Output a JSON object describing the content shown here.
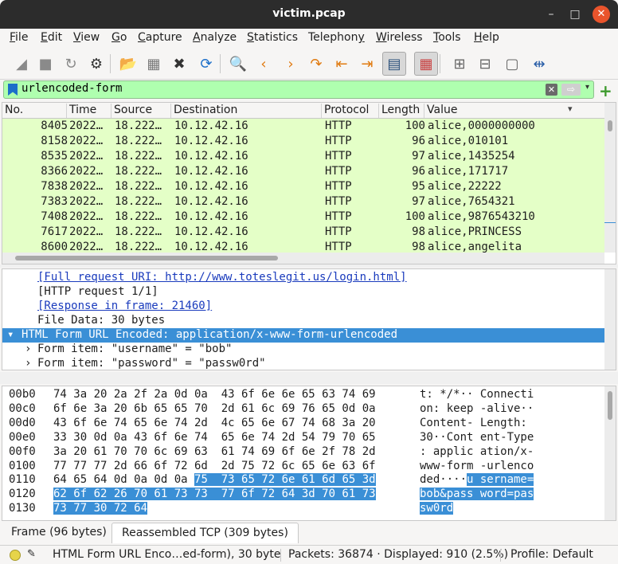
{
  "window": {
    "title": "victim.pcap",
    "minimize": "–",
    "maximize": "□",
    "close": "✕"
  },
  "menu": [
    {
      "key": "F",
      "rest": "ile"
    },
    {
      "key": "E",
      "rest": "dit"
    },
    {
      "key": "V",
      "rest": "iew"
    },
    {
      "key": "G",
      "rest": "o"
    },
    {
      "key": "C",
      "rest": "apture"
    },
    {
      "key": "A",
      "rest": "nalyze"
    },
    {
      "key": "S",
      "rest": "tatistics"
    },
    {
      "key": "",
      "rest": "Telephon",
      "key2": "y"
    },
    {
      "key": "W",
      "rest": "ireless"
    },
    {
      "key": "T",
      "rest": "ools"
    },
    {
      "key": "H",
      "rest": "elp"
    }
  ],
  "toolbar": {
    "icons": [
      "shark-fin-start-icon",
      "stop-capture-icon",
      "restart-capture-icon",
      "capture-options-icon",
      "open-file-icon",
      "save-file-icon",
      "close-file-icon",
      "reload-file-icon",
      "find-packet-icon",
      "go-back-icon",
      "go-forward-icon",
      "go-to-packet-icon",
      "go-first-icon",
      "go-last-icon",
      "autoscroll-icon",
      "colorize-icon",
      "zoom-in-icon",
      "zoom-out-icon",
      "normal-size-icon",
      "resize-columns-icon"
    ]
  },
  "filter": {
    "value": "urlencoded-form",
    "apply_glyph": "⇨",
    "clear_glyph": "✕",
    "dropdown_glyph": "▾",
    "add_glyph": "+"
  },
  "packet_list": {
    "columns": [
      "No.",
      "Time",
      "Source",
      "Destination",
      "Protocol",
      "Length",
      "Value"
    ],
    "sort_glyph": "▾",
    "rows": [
      {
        "no": "8405",
        "time": "2022…",
        "src": "18.222…",
        "dst": "10.12.42.16",
        "proto": "HTTP",
        "len": "100",
        "value": "alice,0000000000"
      },
      {
        "no": "8158",
        "time": "2022…",
        "src": "18.222…",
        "dst": "10.12.42.16",
        "proto": "HTTP",
        "len": "96",
        "value": "alice,010101"
      },
      {
        "no": "8535",
        "time": "2022…",
        "src": "18.222…",
        "dst": "10.12.42.16",
        "proto": "HTTP",
        "len": "97",
        "value": "alice,1435254"
      },
      {
        "no": "8366",
        "time": "2022…",
        "src": "18.222…",
        "dst": "10.12.42.16",
        "proto": "HTTP",
        "len": "96",
        "value": "alice,171717"
      },
      {
        "no": "7838",
        "time": "2022…",
        "src": "18.222…",
        "dst": "10.12.42.16",
        "proto": "HTTP",
        "len": "95",
        "value": "alice,22222"
      },
      {
        "no": "7383",
        "time": "2022…",
        "src": "18.222…",
        "dst": "10.12.42.16",
        "proto": "HTTP",
        "len": "97",
        "value": "alice,7654321"
      },
      {
        "no": "7408",
        "time": "2022…",
        "src": "18.222…",
        "dst": "10.12.42.16",
        "proto": "HTTP",
        "len": "100",
        "value": "alice,9876543210"
      },
      {
        "no": "7617",
        "time": "2022…",
        "src": "18.222…",
        "dst": "10.12.42.16",
        "proto": "HTTP",
        "len": "98",
        "value": "alice,PRINCESS"
      },
      {
        "no": "8600",
        "time": "2022…",
        "src": "18.222…",
        "dst": "10.12.42.16",
        "proto": "HTTP",
        "len": "98",
        "value": "alice,angelita"
      }
    ]
  },
  "details": {
    "lines": [
      {
        "text": "[Full request URI: http://www.toteslegit.us/login.html]",
        "link": true
      },
      {
        "text": "[HTTP request 1/1]",
        "link": false
      },
      {
        "text": "[Response in frame: 21460]",
        "link": true
      },
      {
        "text": "File Data: 30 bytes",
        "link": false
      }
    ],
    "selected": {
      "arrow": "▾",
      "text": "HTML Form URL Encoded: application/x-www-form-urlencoded"
    },
    "children": [
      {
        "arrow": "›",
        "text": "Form item: \"username\" = \"bob\""
      },
      {
        "arrow": "›",
        "text": "Form item: \"password\" = \"passw0rd\""
      }
    ]
  },
  "bytes": {
    "rows": [
      {
        "off": "00b0",
        "hex": "74 3a 20 2a 2f 2a 0d 0a  43 6f 6e 6e 65 63 74 69",
        "hex_hl": "",
        "ascii": "t: */*·· Connecti",
        "ascii_hl": ""
      },
      {
        "off": "00c0",
        "hex": "6f 6e 3a 20 6b 65 65 70  2d 61 6c 69 76 65 0d 0a",
        "hex_hl": "",
        "ascii": "on: keep -alive··",
        "ascii_hl": ""
      },
      {
        "off": "00d0",
        "hex": "43 6f 6e 74 65 6e 74 2d  4c 65 6e 67 74 68 3a 20",
        "hex_hl": "",
        "ascii": "Content- Length: ",
        "ascii_hl": ""
      },
      {
        "off": "00e0",
        "hex": "33 30 0d 0a 43 6f 6e 74  65 6e 74 2d 54 79 70 65",
        "hex_hl": "",
        "ascii": "30··Cont ent-Type",
        "ascii_hl": ""
      },
      {
        "off": "00f0",
        "hex": "3a 20 61 70 70 6c 69 63  61 74 69 6f 6e 2f 78 2d",
        "hex_hl": "",
        "ascii": ": applic ation/x-",
        "ascii_hl": ""
      },
      {
        "off": "0100",
        "hex": "77 77 77 2d 66 6f 72 6d  2d 75 72 6c 65 6e 63 6f",
        "hex_hl": "",
        "ascii": "www-form -urlenco",
        "ascii_hl": ""
      },
      {
        "off": "0110",
        "hex": "64 65 64 0d 0a 0d 0a ",
        "hex_hl": "75  73 65 72 6e 61 6d 65 3d",
        "ascii": "ded····",
        "ascii_hl": "u sername="
      },
      {
        "off": "0120",
        "hex": "",
        "hex_hl": "62 6f 62 26 70 61 73 73  77 6f 72 64 3d 70 61 73",
        "ascii": "",
        "ascii_hl": "bob&pass word=pas"
      },
      {
        "off": "0130",
        "hex": "",
        "hex_hl": "73 77 30 72 64",
        "ascii": "",
        "ascii_hl": "sw0rd"
      }
    ]
  },
  "bytes_tabs": [
    "Frame (96 bytes)",
    "Reassembled TCP (309 bytes)"
  ],
  "status": {
    "field": "HTML Form URL Enco…ed-form), 30 byte",
    "packets": "Packets: 36874 · Displayed: 910 (2.5%)",
    "profile": "Profile: Default"
  }
}
